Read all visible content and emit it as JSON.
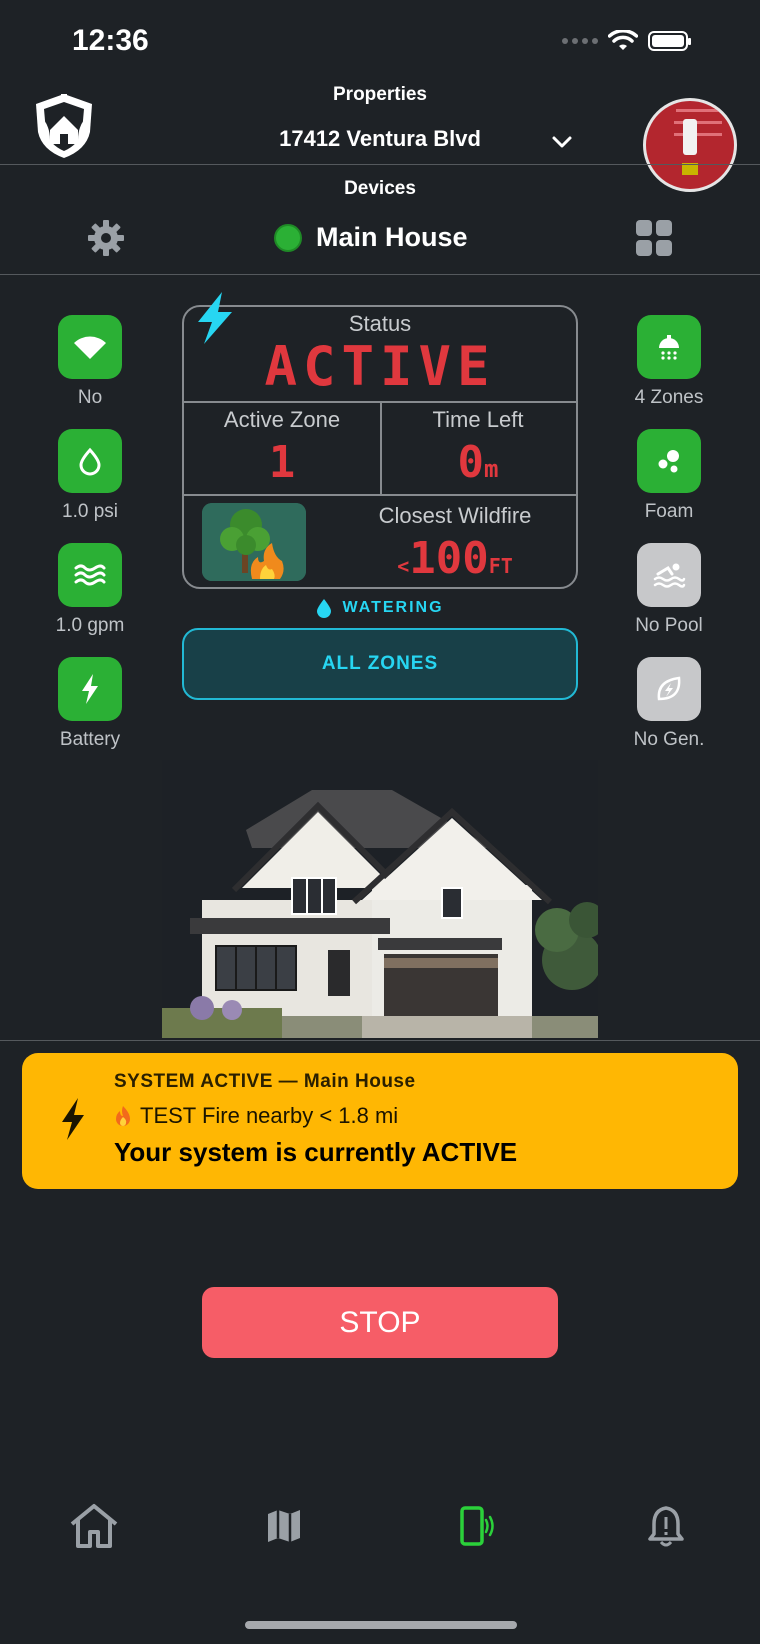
{
  "status_bar": {
    "time": "12:36"
  },
  "header": {
    "properties_label": "Properties",
    "property_name": "17412 Ventura Blvd",
    "devices_label": "Devices",
    "device_name": "Main House"
  },
  "left_tiles": [
    {
      "icon": "wifi-icon",
      "label": "No"
    },
    {
      "icon": "water-drop-icon",
      "label": "1.0 psi"
    },
    {
      "icon": "water-flow-icon",
      "label": "1.0 gpm"
    },
    {
      "icon": "lightning-icon",
      "label": "Battery"
    }
  ],
  "right_tiles": [
    {
      "icon": "sprinkler-icon",
      "label": "4 Zones"
    },
    {
      "icon": "foam-icon",
      "label": "Foam"
    },
    {
      "icon": "pool-icon",
      "label": "No Pool"
    },
    {
      "icon": "generator-icon",
      "label": "No Gen."
    }
  ],
  "status_panel": {
    "status_label": "Status",
    "status_value": "ACTIVE",
    "active_zone_label": "Active Zone",
    "active_zone_value": "1",
    "time_left_label": "Time Left",
    "time_left_value": "0",
    "time_left_unit": "m",
    "wildfire_label": "Closest Wildfire",
    "wildfire_prefix": "<",
    "wildfire_value": "100",
    "wildfire_unit": "FT"
  },
  "watering_label": "WATERING",
  "zones_button": "ALL ZONES",
  "banner": {
    "title": "SYSTEM ACTIVE — Main House",
    "fire_line": "TEST Fire nearby < 1.8 mi",
    "message": "Your system is currently ACTIVE"
  },
  "stop_button": "STOP",
  "colors": {
    "background": "#1e2226",
    "accent_green": "#2bb035",
    "alert_red": "#e0383e",
    "cyan": "#27d6f2",
    "banner_yellow": "#ffb703",
    "stop_red": "#f65d67"
  }
}
